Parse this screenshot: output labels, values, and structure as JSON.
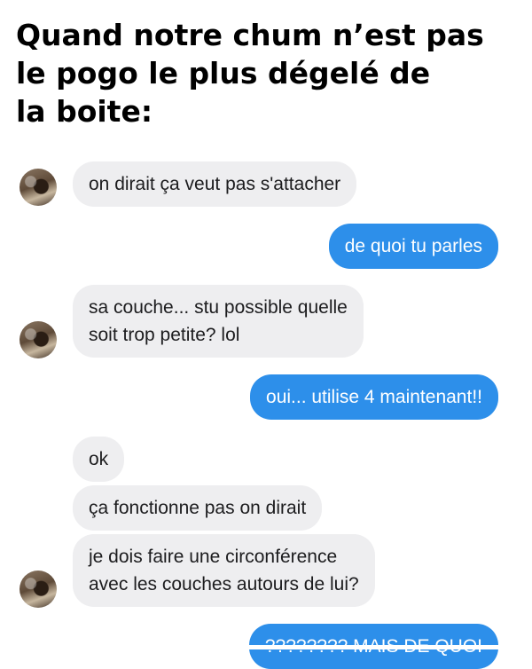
{
  "caption": {
    "line1": "Quand notre chum n’est pas",
    "line2": "le pogo le plus dégelé de",
    "line3": "la boite:"
  },
  "messages": [
    {
      "side": "incoming",
      "text": "on dirait ça veut pas s'attacher"
    },
    {
      "side": "outgoing",
      "text": "de quoi tu parles"
    },
    {
      "side": "incoming",
      "lines": [
        "sa couche... stu possible quelle",
        "soit trop petite? lol"
      ]
    },
    {
      "side": "outgoing",
      "text": "oui... utilise 4 maintenant!!"
    },
    {
      "side": "incoming",
      "text": "ok"
    },
    {
      "side": "incoming",
      "text": "ça fonctionne pas on dirait"
    },
    {
      "side": "incoming",
      "lines": [
        "je dois faire une circonférence",
        "avec les couches autours de lui?"
      ]
    },
    {
      "side": "outgoing",
      "text": "???????? MAIS DE QUOI"
    }
  ],
  "colors": {
    "incoming_bubble": "#eeeef0",
    "outgoing_bubble": "#2d8fea",
    "incoming_text": "#1c1c1e",
    "outgoing_text": "#ffffff"
  },
  "icons": {
    "avatar": "contact-avatar-photo"
  }
}
